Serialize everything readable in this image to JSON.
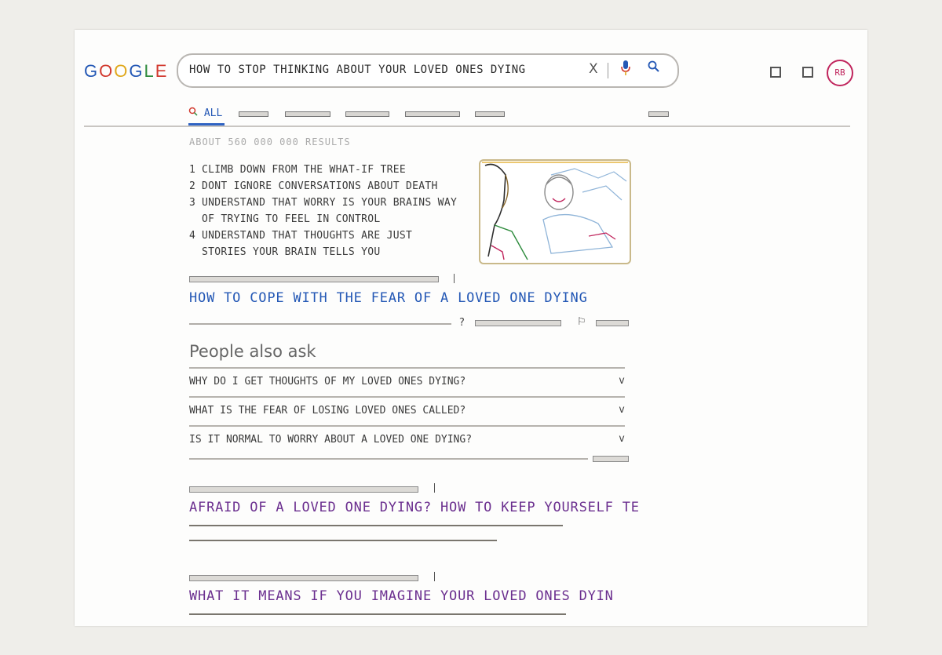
{
  "header": {
    "logo": [
      "G",
      "O",
      "O",
      "G",
      "L",
      "E"
    ],
    "logo_colors": [
      "#2458b5",
      "#d23a2f",
      "#e0a81c",
      "#2458b5",
      "#2e8b3d",
      "#d23a2f"
    ],
    "search_query": "HOW TO STOP THINKING ABOUT YOUR LOVED ONES DYING",
    "clear_icon": "X",
    "mic_icon": "🎙",
    "search_icon": "⌕",
    "avatar_initials": "RB",
    "accent_color": "#c0245c"
  },
  "tabs": {
    "active_label": "ALL",
    "active_icon": "search-icon"
  },
  "results": {
    "count_text": "ABOUT 560 000 000 RESULTS",
    "snippet": [
      {
        "num": "1",
        "text": "CLIMB DOWN FROM THE WHAT-IF TREE"
      },
      {
        "num": "2",
        "text": "DONT IGNORE CONVERSATIONS ABOUT DEATH"
      },
      {
        "num": "3",
        "text": "UNDERSTAND THAT WORRY IS YOUR BRAINS WAY OF TRYING TO FEEL IN CONTROL"
      },
      {
        "num": "4",
        "text": "UNDERSTAND THAT THOUGHTS ARE JUST STORIES YOUR BRAIN TELLS YOU"
      }
    ],
    "featured_title": "HOW TO COPE WITH THE FEAR OF A LOVED ONE DYING",
    "help_mark": "?",
    "feedback_icon": "⚐"
  },
  "people_also_ask": {
    "title": "People also ask",
    "questions": [
      "WHY DO I GET THOUGHTS OF MY LOVED ONES DYING?",
      "WHAT IS THE FEAR OF LOSING LOVED ONES CALLED?",
      "IS IT NORMAL TO WORRY ABOUT A LOVED ONE DYING?"
    ],
    "chevron": "v"
  },
  "more_results": [
    {
      "title": "AFRAID OF A LOVED ONE DYING? HOW TO KEEP YOURSELF TE"
    },
    {
      "title": "WHAT IT MEANS IF YOU IMAGINE YOUR LOVED ONES DYIN"
    }
  ]
}
